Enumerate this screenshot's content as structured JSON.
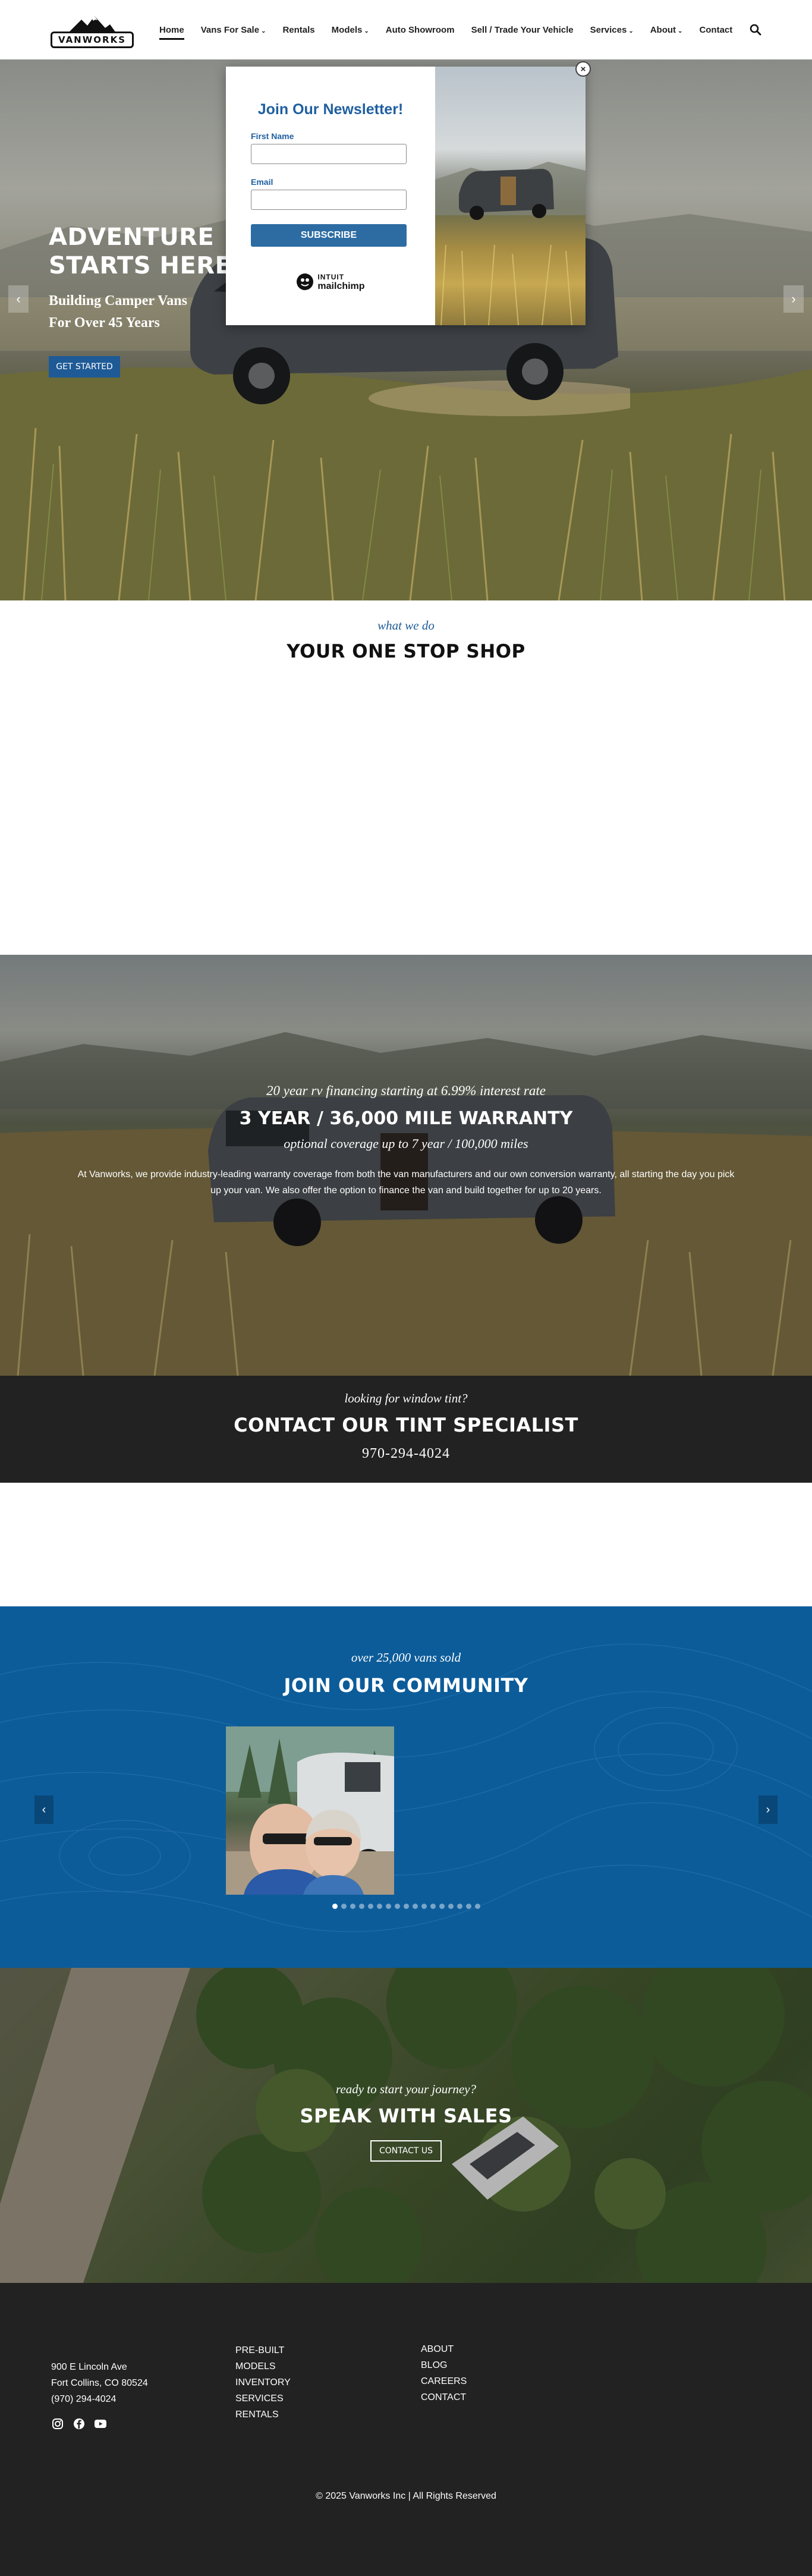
{
  "header": {
    "logo_text": "VANWORKS",
    "nav": [
      {
        "label": "Home",
        "active": true,
        "dropdown": false
      },
      {
        "label": "Vans For Sale",
        "active": false,
        "dropdown": true
      },
      {
        "label": "Rentals",
        "active": false,
        "dropdown": false
      },
      {
        "label": "Models",
        "active": false,
        "dropdown": true
      },
      {
        "label": "Auto Showroom",
        "active": false,
        "dropdown": false
      },
      {
        "label": "Sell / Trade Your Vehicle",
        "active": false,
        "dropdown": false
      },
      {
        "label": "Services",
        "active": false,
        "dropdown": true
      },
      {
        "label": "About",
        "active": false,
        "dropdown": true
      },
      {
        "label": "Contact",
        "active": false,
        "dropdown": false
      }
    ],
    "chevron": "⌄"
  },
  "hero": {
    "title_line1": "ADVENTURE",
    "title_line2": "STARTS HERE",
    "subtitle_line1": "Building Camper Vans",
    "subtitle_line2": "For Over 45 Years",
    "cta_label": "GET STARTED",
    "prev_glyph": "‹",
    "next_glyph": "›"
  },
  "newsletter_modal": {
    "title": "Join Our Newsletter!",
    "first_name_label": "First Name",
    "first_name_value": "",
    "email_label": "Email",
    "email_value": "",
    "submit_label": "SUBSCRIBE",
    "close_glyph": "×",
    "badge_top": "INTUIT",
    "badge_name": "mailchimp"
  },
  "one_stop_shop": {
    "kicker": "what we do",
    "title": "YOUR ONE STOP SHOP"
  },
  "warranty": {
    "kicker": "20 year rv financing starting at 6.99% interest rate",
    "title": "3 YEAR / 36,000 MILE WARRANTY",
    "subtitle": "optional coverage up to 7 year / 100,000 miles",
    "body": "At Vanworks, we provide industry-leading warranty coverage from both the van manufacturers and our own conversion warranty, all starting the day you pick up your van. We also offer the option to finance the van and build together for up to 20 years."
  },
  "tint": {
    "kicker": "looking for window tint?",
    "title": "CONTACT OUR TINT SPECIALIST",
    "phone": "970-294-4024"
  },
  "community": {
    "kicker": "over 25,000 vans sold",
    "title": "JOIN OUR COMMUNITY",
    "prev_glyph": "‹",
    "next_glyph": "›",
    "slide_count": 17,
    "active_slide": 0
  },
  "sales": {
    "kicker": "ready to start your journey?",
    "title": "SPEAK WITH SALES",
    "cta_label": "CONTACT US"
  },
  "footer": {
    "address_line1": "900 E Lincoln Ave",
    "address_line2": "Fort Collins, CO 80524",
    "phone": "(970) 294-4024",
    "links_col1": [
      "PRE-BUILT",
      "MODELS",
      "INVENTORY",
      "SERVICES",
      "RENTALS"
    ],
    "links_col2": [
      "ABOUT",
      "BLOG",
      "CAREERS",
      "CONTACT"
    ],
    "socials": [
      "instagram-icon",
      "facebook-icon",
      "youtube-icon"
    ],
    "copyright": "© 2025 Vanworks Inc | All Rights Reserved"
  },
  "colors": {
    "brand_blue": "#1e5a96",
    "community_blue": "#0c5c9a",
    "dark": "#222222",
    "modal_title": "#1f5fa0"
  }
}
